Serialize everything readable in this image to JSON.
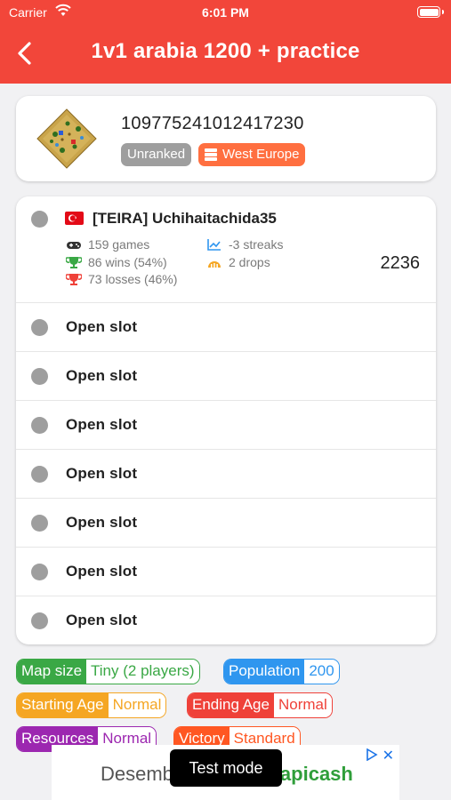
{
  "status_bar": {
    "carrier": "Carrier",
    "time": "6:01 PM"
  },
  "header": {
    "title": "1v1 arabia 1200 + practice",
    "back_icon": "chevron-left-icon",
    "color": "#f2463a"
  },
  "match": {
    "id": "109775241012417230",
    "ranked_badge": "Unranked",
    "server": "West Europe",
    "server_icon": "server-icon",
    "map_icon": "arabia-map-icon"
  },
  "player": {
    "name": "[TEIRA] Uchihaitachida35",
    "flag_icon": "turkey-flag-icon",
    "games": "159 games",
    "wins": "86 wins (54%)",
    "losses": "73 losses (46%)",
    "streaks": "-3 streaks",
    "drops": "2 drops",
    "rating": "2236"
  },
  "open_slots": [
    "Open slot",
    "Open slot",
    "Open slot",
    "Open slot",
    "Open slot",
    "Open slot",
    "Open slot"
  ],
  "settings": {
    "map_size": {
      "label": "Map size",
      "value": "Tiny (2 players)",
      "color": "#3aa845"
    },
    "population": {
      "label": "Population",
      "value": "200",
      "color": "#2f96ef"
    },
    "starting_age": {
      "label": "Starting Age",
      "value": "Normal",
      "color": "#f5a623"
    },
    "ending_age": {
      "label": "Ending Age",
      "value": "Normal",
      "color": "#ef4139"
    },
    "resources": {
      "label": "Resources",
      "value": "Normal",
      "color": "#9c27b0"
    },
    "victory": {
      "label": "Victory",
      "value": "Standard",
      "color": "#ff5722"
    }
  },
  "ad": {
    "text_start": "Desemb",
    "text_brand": "apicash",
    "test_mode": "Test mode"
  }
}
